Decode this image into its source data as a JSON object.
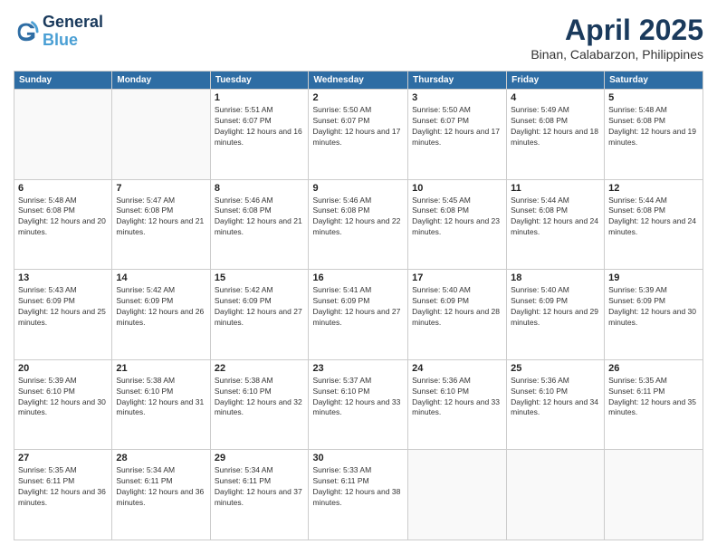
{
  "header": {
    "logo_line1": "General",
    "logo_line2": "Blue",
    "month_year": "April 2025",
    "location": "Binan, Calabarzon, Philippines"
  },
  "days_of_week": [
    "Sunday",
    "Monday",
    "Tuesday",
    "Wednesday",
    "Thursday",
    "Friday",
    "Saturday"
  ],
  "weeks": [
    [
      {
        "day": "",
        "info": ""
      },
      {
        "day": "",
        "info": ""
      },
      {
        "day": "1",
        "info": "Sunrise: 5:51 AM\nSunset: 6:07 PM\nDaylight: 12 hours and 16 minutes."
      },
      {
        "day": "2",
        "info": "Sunrise: 5:50 AM\nSunset: 6:07 PM\nDaylight: 12 hours and 17 minutes."
      },
      {
        "day": "3",
        "info": "Sunrise: 5:50 AM\nSunset: 6:07 PM\nDaylight: 12 hours and 17 minutes."
      },
      {
        "day": "4",
        "info": "Sunrise: 5:49 AM\nSunset: 6:08 PM\nDaylight: 12 hours and 18 minutes."
      },
      {
        "day": "5",
        "info": "Sunrise: 5:48 AM\nSunset: 6:08 PM\nDaylight: 12 hours and 19 minutes."
      }
    ],
    [
      {
        "day": "6",
        "info": "Sunrise: 5:48 AM\nSunset: 6:08 PM\nDaylight: 12 hours and 20 minutes."
      },
      {
        "day": "7",
        "info": "Sunrise: 5:47 AM\nSunset: 6:08 PM\nDaylight: 12 hours and 21 minutes."
      },
      {
        "day": "8",
        "info": "Sunrise: 5:46 AM\nSunset: 6:08 PM\nDaylight: 12 hours and 21 minutes."
      },
      {
        "day": "9",
        "info": "Sunrise: 5:46 AM\nSunset: 6:08 PM\nDaylight: 12 hours and 22 minutes."
      },
      {
        "day": "10",
        "info": "Sunrise: 5:45 AM\nSunset: 6:08 PM\nDaylight: 12 hours and 23 minutes."
      },
      {
        "day": "11",
        "info": "Sunrise: 5:44 AM\nSunset: 6:08 PM\nDaylight: 12 hours and 24 minutes."
      },
      {
        "day": "12",
        "info": "Sunrise: 5:44 AM\nSunset: 6:08 PM\nDaylight: 12 hours and 24 minutes."
      }
    ],
    [
      {
        "day": "13",
        "info": "Sunrise: 5:43 AM\nSunset: 6:09 PM\nDaylight: 12 hours and 25 minutes."
      },
      {
        "day": "14",
        "info": "Sunrise: 5:42 AM\nSunset: 6:09 PM\nDaylight: 12 hours and 26 minutes."
      },
      {
        "day": "15",
        "info": "Sunrise: 5:42 AM\nSunset: 6:09 PM\nDaylight: 12 hours and 27 minutes."
      },
      {
        "day": "16",
        "info": "Sunrise: 5:41 AM\nSunset: 6:09 PM\nDaylight: 12 hours and 27 minutes."
      },
      {
        "day": "17",
        "info": "Sunrise: 5:40 AM\nSunset: 6:09 PM\nDaylight: 12 hours and 28 minutes."
      },
      {
        "day": "18",
        "info": "Sunrise: 5:40 AM\nSunset: 6:09 PM\nDaylight: 12 hours and 29 minutes."
      },
      {
        "day": "19",
        "info": "Sunrise: 5:39 AM\nSunset: 6:09 PM\nDaylight: 12 hours and 30 minutes."
      }
    ],
    [
      {
        "day": "20",
        "info": "Sunrise: 5:39 AM\nSunset: 6:10 PM\nDaylight: 12 hours and 30 minutes."
      },
      {
        "day": "21",
        "info": "Sunrise: 5:38 AM\nSunset: 6:10 PM\nDaylight: 12 hours and 31 minutes."
      },
      {
        "day": "22",
        "info": "Sunrise: 5:38 AM\nSunset: 6:10 PM\nDaylight: 12 hours and 32 minutes."
      },
      {
        "day": "23",
        "info": "Sunrise: 5:37 AM\nSunset: 6:10 PM\nDaylight: 12 hours and 33 minutes."
      },
      {
        "day": "24",
        "info": "Sunrise: 5:36 AM\nSunset: 6:10 PM\nDaylight: 12 hours and 33 minutes."
      },
      {
        "day": "25",
        "info": "Sunrise: 5:36 AM\nSunset: 6:10 PM\nDaylight: 12 hours and 34 minutes."
      },
      {
        "day": "26",
        "info": "Sunrise: 5:35 AM\nSunset: 6:11 PM\nDaylight: 12 hours and 35 minutes."
      }
    ],
    [
      {
        "day": "27",
        "info": "Sunrise: 5:35 AM\nSunset: 6:11 PM\nDaylight: 12 hours and 36 minutes."
      },
      {
        "day": "28",
        "info": "Sunrise: 5:34 AM\nSunset: 6:11 PM\nDaylight: 12 hours and 36 minutes."
      },
      {
        "day": "29",
        "info": "Sunrise: 5:34 AM\nSunset: 6:11 PM\nDaylight: 12 hours and 37 minutes."
      },
      {
        "day": "30",
        "info": "Sunrise: 5:33 AM\nSunset: 6:11 PM\nDaylight: 12 hours and 38 minutes."
      },
      {
        "day": "",
        "info": ""
      },
      {
        "day": "",
        "info": ""
      },
      {
        "day": "",
        "info": ""
      }
    ]
  ]
}
